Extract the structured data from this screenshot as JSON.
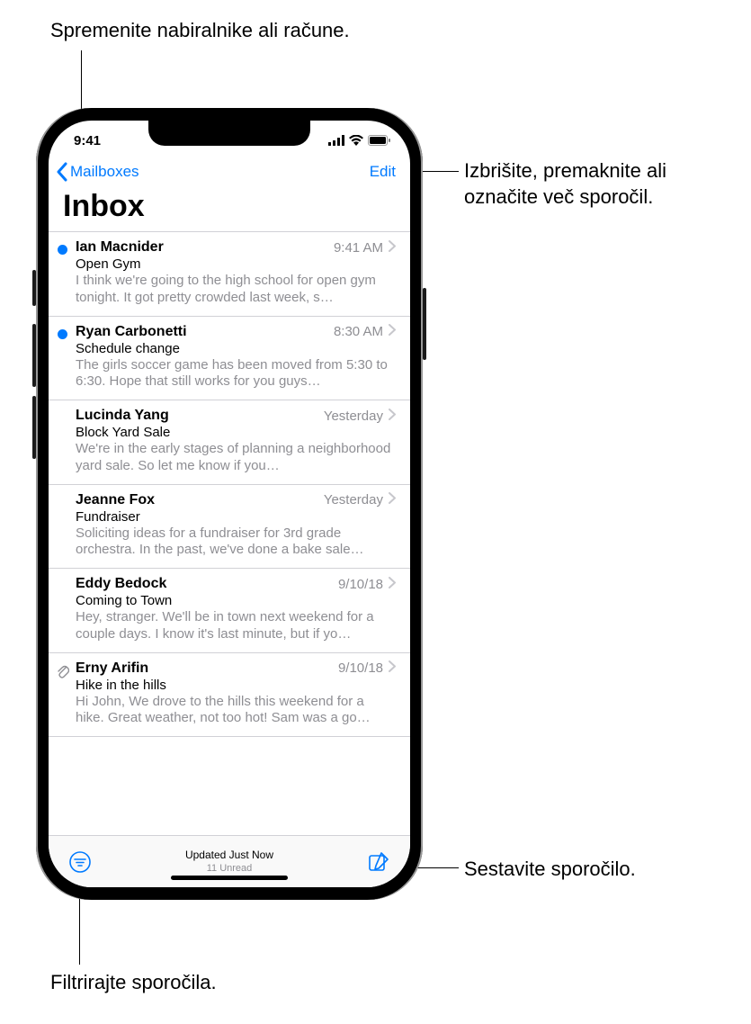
{
  "callouts": {
    "topLeft": "Spremenite nabiralnike ali račune.",
    "topRight": "Izbrišite, premaknite ali označite več sporočil.",
    "bottomRight": "Sestavite sporočilo.",
    "bottomLeft": "Filtrirajte sporočila."
  },
  "statusBar": {
    "time": "9:41"
  },
  "nav": {
    "back": "Mailboxes",
    "edit": "Edit"
  },
  "title": "Inbox",
  "messages": [
    {
      "sender": "Ian Macnider",
      "time": "9:41 AM",
      "subject": "Open Gym",
      "preview": "I think we're going to the high school for open gym tonight. It got pretty crowded last week, s…",
      "unread": true,
      "attachment": false
    },
    {
      "sender": "Ryan Carbonetti",
      "time": "8:30 AM",
      "subject": "Schedule change",
      "preview": "The girls soccer game has been moved from 5:30 to 6:30. Hope that still works for you guys…",
      "unread": true,
      "attachment": false
    },
    {
      "sender": "Lucinda Yang",
      "time": "Yesterday",
      "subject": "Block Yard Sale",
      "preview": "We're in the early stages of planning a neighborhood yard sale. So let me know if you…",
      "unread": false,
      "attachment": false
    },
    {
      "sender": "Jeanne Fox",
      "time": "Yesterday",
      "subject": "Fundraiser",
      "preview": "Soliciting ideas for a fundraiser for 3rd grade orchestra. In the past, we've done a bake sale…",
      "unread": false,
      "attachment": false
    },
    {
      "sender": "Eddy Bedock",
      "time": "9/10/18",
      "subject": "Coming to Town",
      "preview": "Hey, stranger. We'll be in town next weekend for a couple days. I know it's last minute, but if yo…",
      "unread": false,
      "attachment": false
    },
    {
      "sender": "Erny Arifin",
      "time": "9/10/18",
      "subject": "Hike in the hills",
      "preview": "Hi John, We drove to the hills this weekend for a hike. Great weather, not too hot! Sam was a go…",
      "unread": false,
      "attachment": true
    }
  ],
  "toolbar": {
    "statusLine1": "Updated Just Now",
    "statusLine2": "11 Unread"
  }
}
